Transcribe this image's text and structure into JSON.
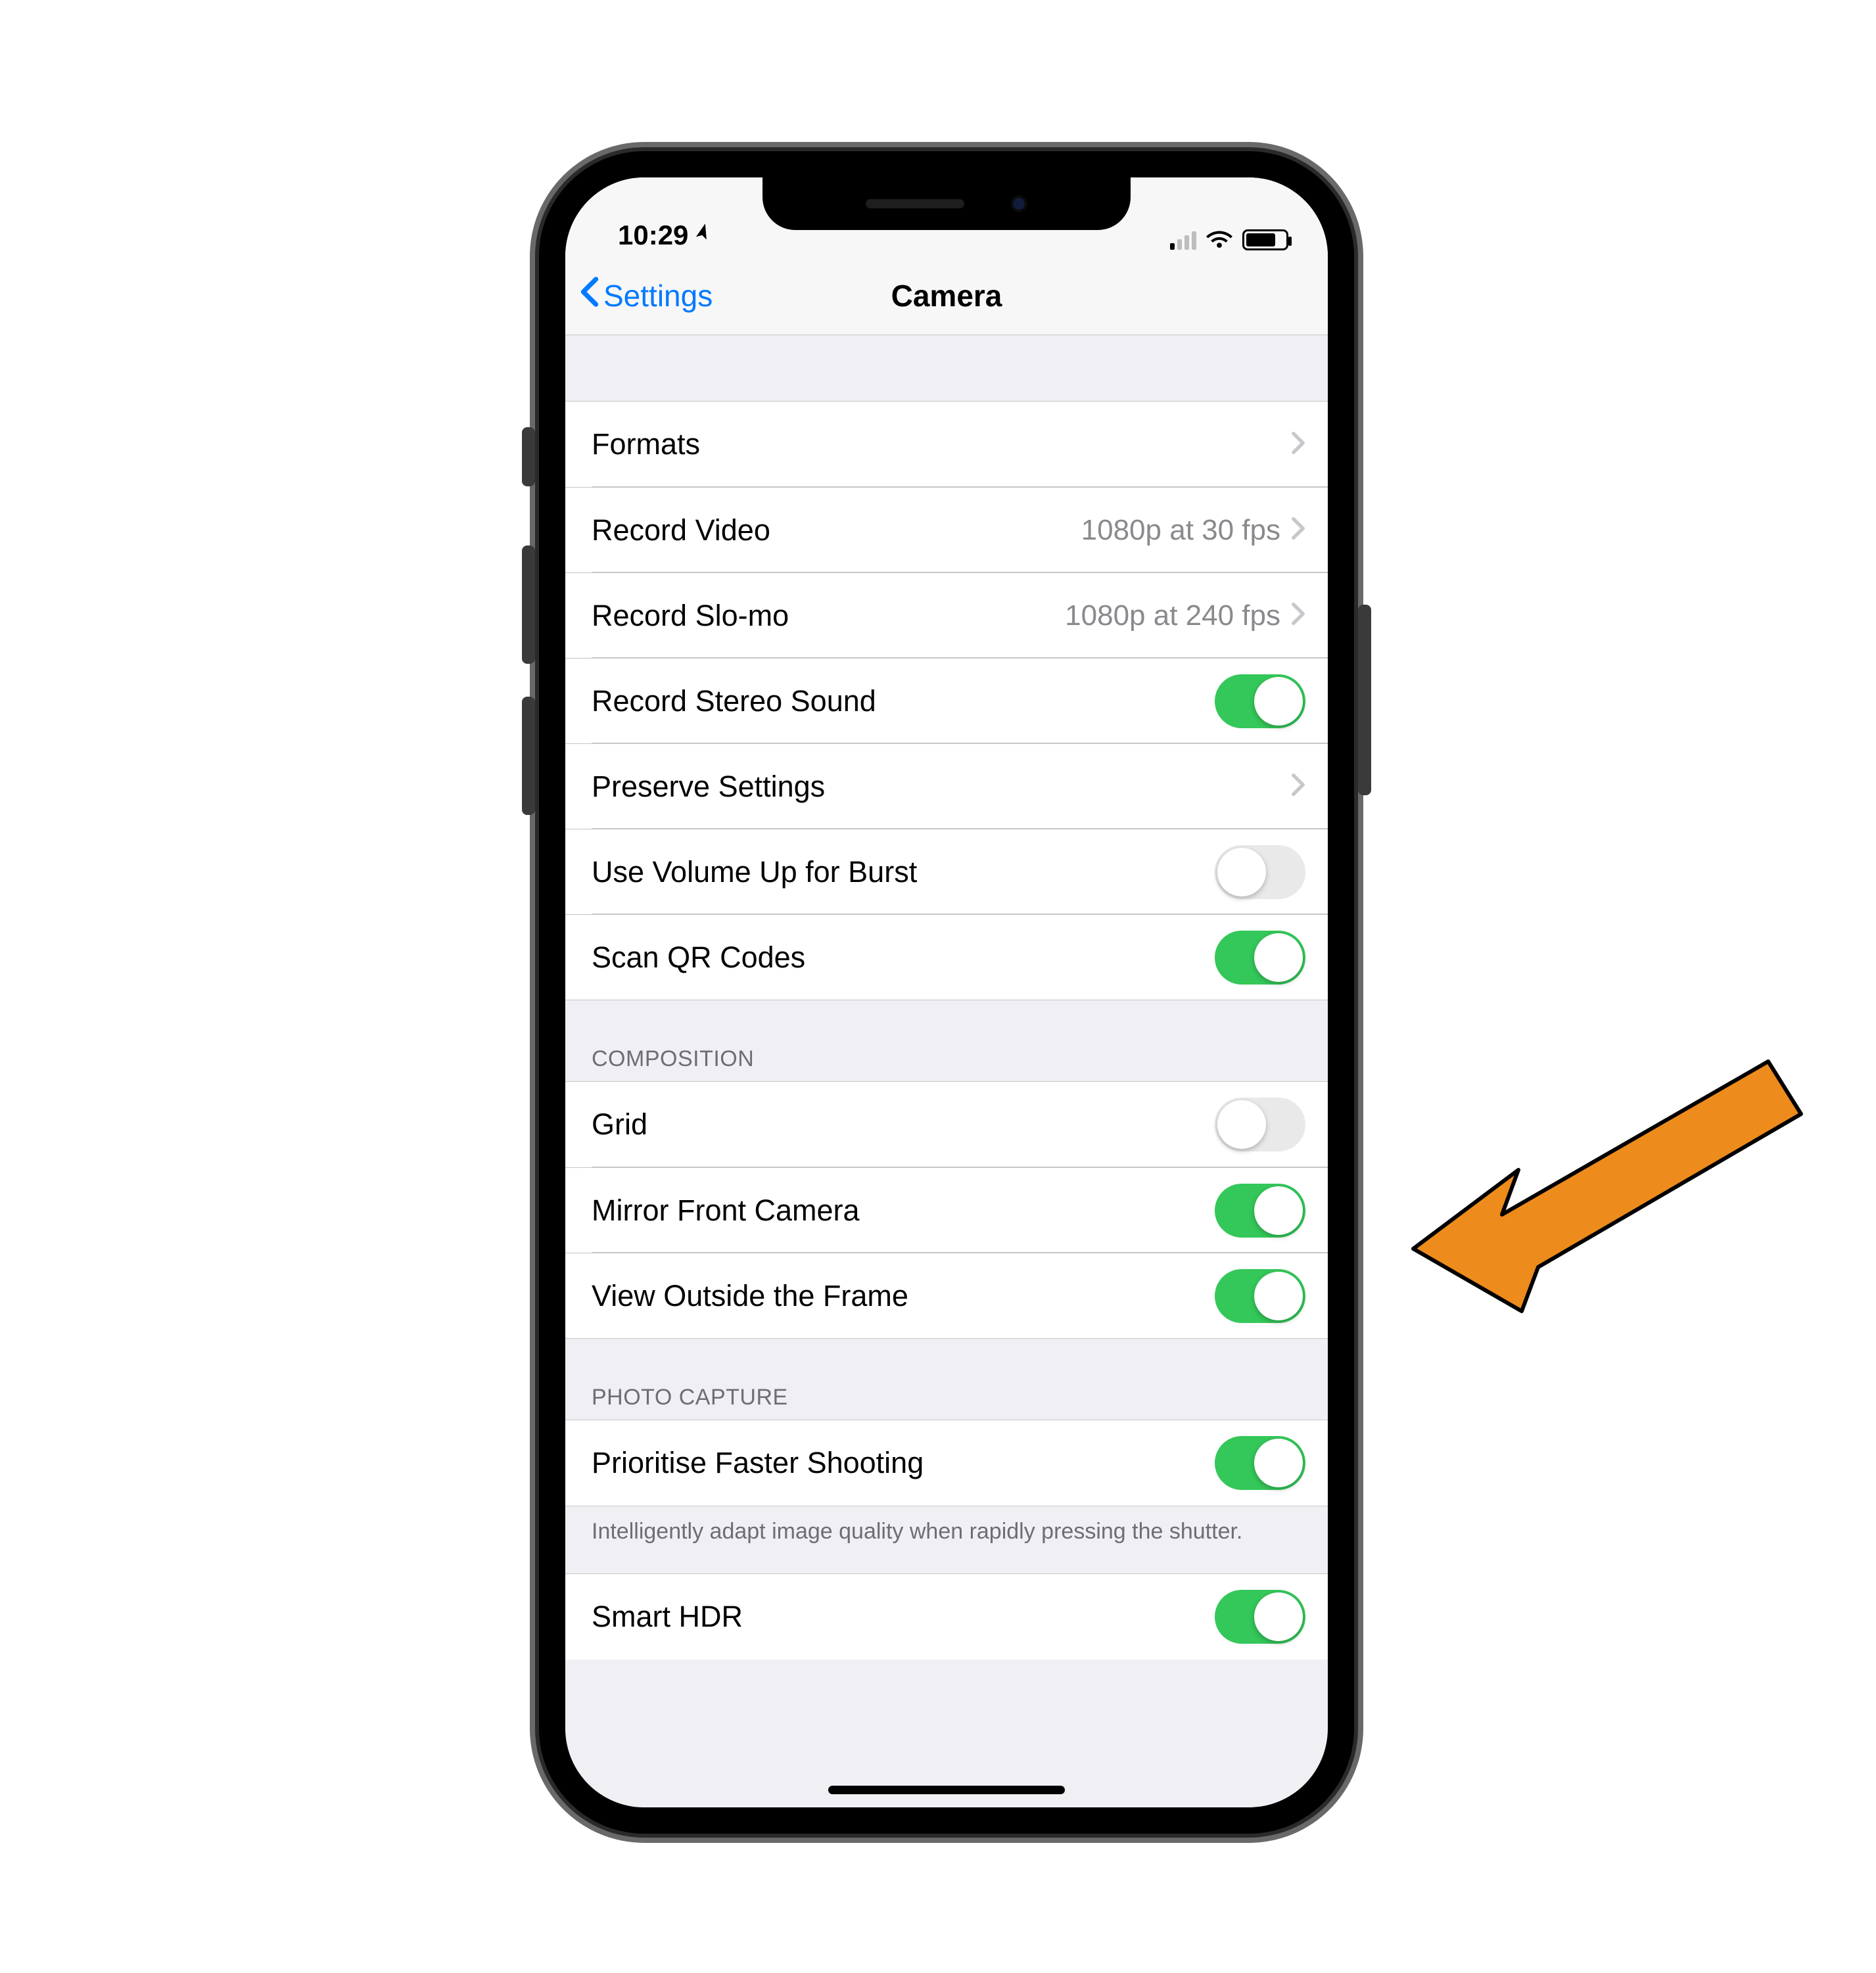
{
  "status": {
    "time": "10:29",
    "location_glyph": "➤"
  },
  "nav": {
    "back_label": "Settings",
    "title": "Camera"
  },
  "group1": {
    "rows": [
      {
        "label": "Formats",
        "detail": "",
        "type": "disclosure",
        "on": false
      },
      {
        "label": "Record Video",
        "detail": "1080p at 30 fps",
        "type": "disclosure",
        "on": false
      },
      {
        "label": "Record Slo-mo",
        "detail": "1080p at 240 fps",
        "type": "disclosure",
        "on": false
      },
      {
        "label": "Record Stereo Sound",
        "detail": "",
        "type": "toggle",
        "on": true
      },
      {
        "label": "Preserve Settings",
        "detail": "",
        "type": "disclosure",
        "on": false
      },
      {
        "label": "Use Volume Up for Burst",
        "detail": "",
        "type": "toggle",
        "on": false
      },
      {
        "label": "Scan QR Codes",
        "detail": "",
        "type": "toggle",
        "on": true
      }
    ]
  },
  "group2": {
    "header": "COMPOSITION",
    "rows": [
      {
        "label": "Grid",
        "type": "toggle",
        "on": false
      },
      {
        "label": "Mirror Front Camera",
        "type": "toggle",
        "on": true
      },
      {
        "label": "View Outside the Frame",
        "type": "toggle",
        "on": true
      }
    ]
  },
  "group3": {
    "header": "PHOTO CAPTURE",
    "rows": [
      {
        "label": "Prioritise Faster Shooting",
        "type": "toggle",
        "on": true
      }
    ],
    "footer": "Intelligently adapt image quality when rapidly pressing the shutter."
  },
  "group4": {
    "rows": [
      {
        "label": "Smart HDR",
        "type": "toggle",
        "on": true
      }
    ]
  }
}
